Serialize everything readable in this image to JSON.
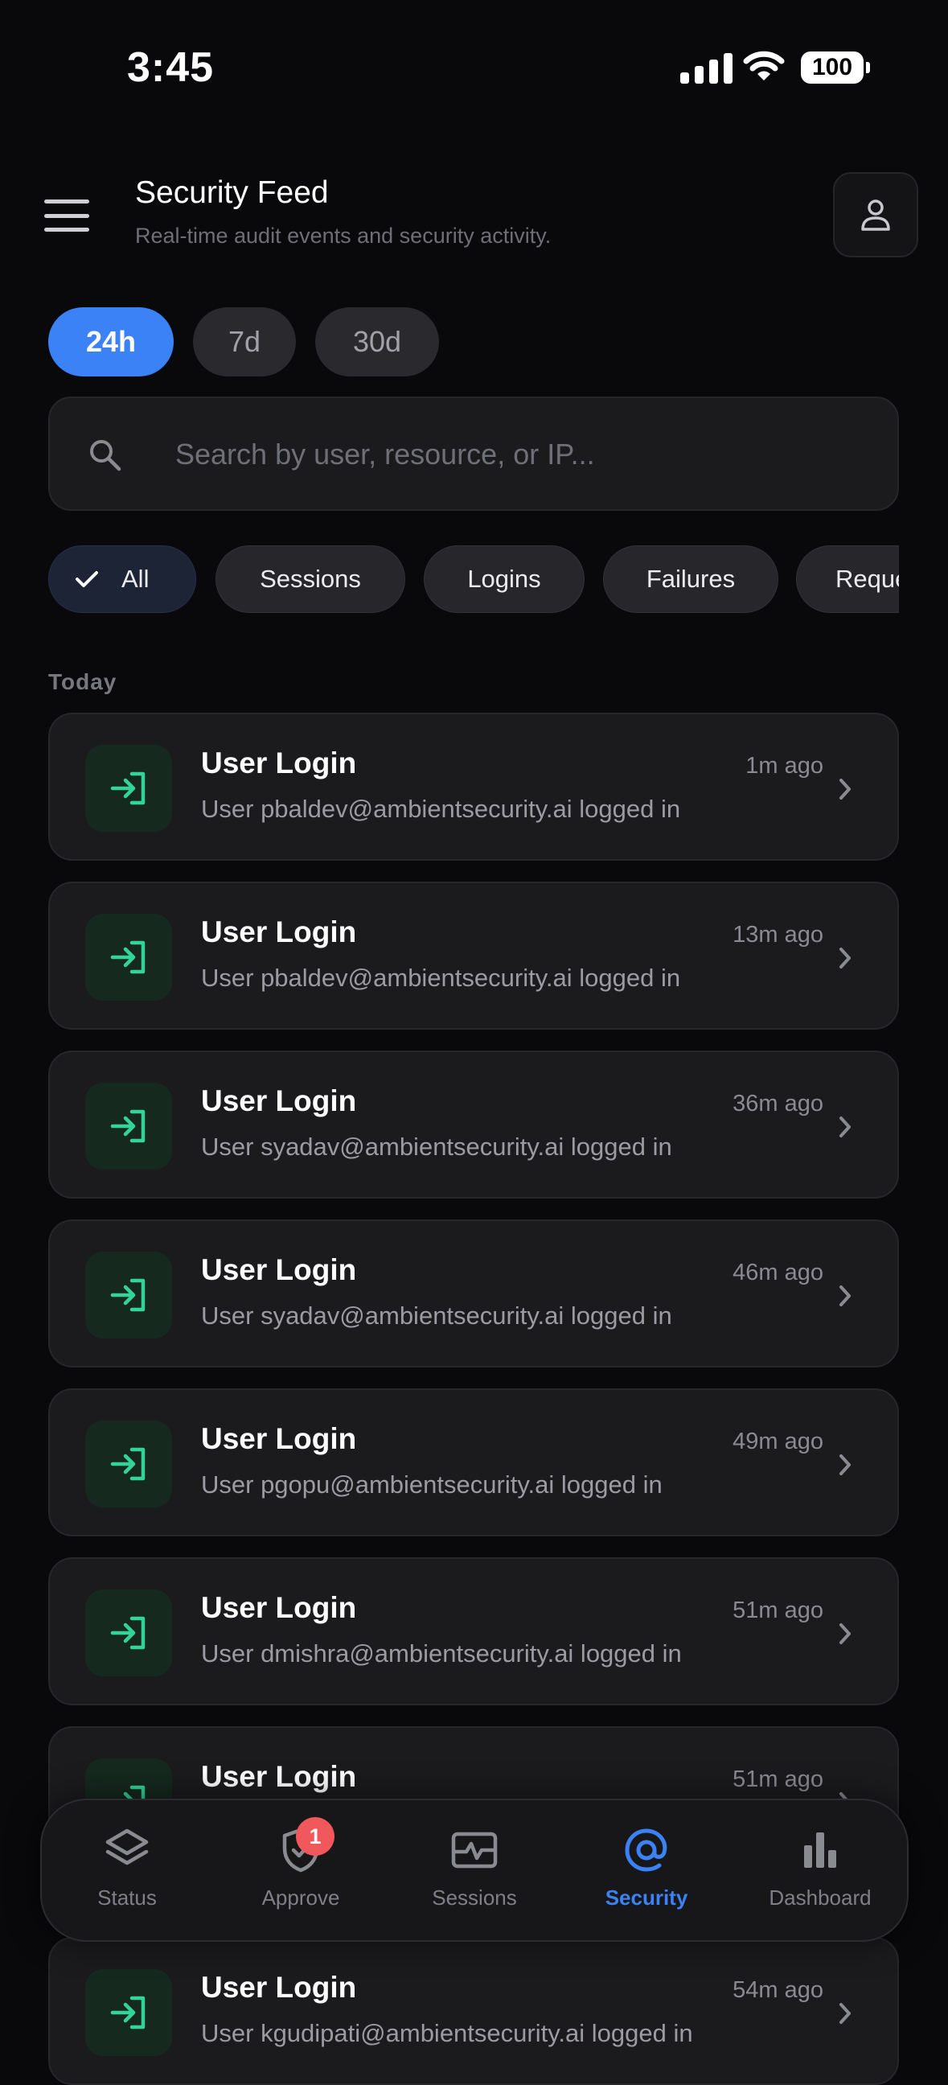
{
  "status_bar": {
    "time": "3:45",
    "battery": "100"
  },
  "header": {
    "title": "Security Feed",
    "subtitle": "Real-time audit events and security activity."
  },
  "time_ranges": [
    {
      "label": "24h",
      "active": true
    },
    {
      "label": "7d",
      "active": false
    },
    {
      "label": "30d",
      "active": false
    }
  ],
  "search": {
    "placeholder": "Search by user, resource, or IP..."
  },
  "filters": [
    "All",
    "Sessions",
    "Logins",
    "Failures",
    "Requests"
  ],
  "section_label": "Today",
  "events": [
    {
      "title": "User Login",
      "desc": "User pbaldev@ambientsecurity.ai logged in",
      "time": "1m ago",
      "icon": "login-icon"
    },
    {
      "title": "User Login",
      "desc": "User pbaldev@ambientsecurity.ai logged in",
      "time": "13m ago",
      "icon": "login-icon"
    },
    {
      "title": "User Login",
      "desc": "User syadav@ambientsecurity.ai logged in",
      "time": "36m ago",
      "icon": "login-icon"
    },
    {
      "title": "User Login",
      "desc": "User syadav@ambientsecurity.ai logged in",
      "time": "46m ago",
      "icon": "login-icon"
    },
    {
      "title": "User Login",
      "desc": "User pgopu@ambientsecurity.ai logged in",
      "time": "49m ago",
      "icon": "login-icon"
    },
    {
      "title": "User Login",
      "desc": "User dmishra@ambientsecurity.ai logged in",
      "time": "51m ago",
      "icon": "login-icon"
    },
    {
      "title": "User Login",
      "desc": "",
      "time": "51m ago",
      "icon": "login-icon"
    },
    {
      "title": "User Login",
      "desc": "User kgudipati@ambientsecurity.ai logged in",
      "time": "54m ago",
      "icon": "login-icon"
    }
  ],
  "tabs": [
    {
      "label": "Status",
      "icon": "layers-icon",
      "active": false
    },
    {
      "label": "Approve",
      "icon": "shield-check-icon",
      "active": false,
      "badge": "1"
    },
    {
      "label": "Sessions",
      "icon": "activity-icon",
      "active": false
    },
    {
      "label": "Security",
      "icon": "at-sign-icon",
      "active": true
    },
    {
      "label": "Dashboard",
      "icon": "bar-chart-icon",
      "active": false
    }
  ],
  "colors": {
    "accent": "#3b82f6",
    "login_green": "#34d399",
    "badge_red": "#f0585b"
  }
}
